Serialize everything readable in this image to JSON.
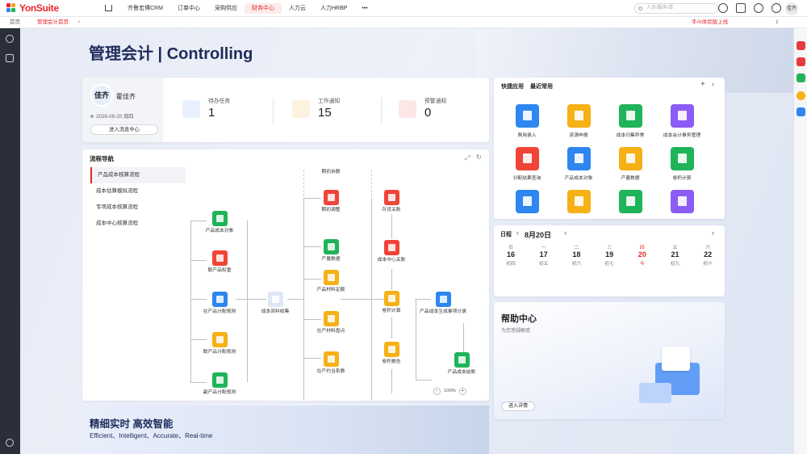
{
  "brand": {
    "name": "YonSuite"
  },
  "top_menu": [
    {
      "label": "齐鲁宏博CRM"
    },
    {
      "label": "订单中心"
    },
    {
      "label": "采购供应"
    },
    {
      "label": "财务中心",
      "active": true
    },
    {
      "label": "人力云"
    },
    {
      "label": "人力HRBP"
    },
    {
      "label": "•••"
    }
  ],
  "search": {
    "placeholder": "人员/服务/单"
  },
  "user_avatar_top": "佳齐",
  "tabs": {
    "home": "首页",
    "current": "管理会计首页",
    "close": "×"
  },
  "promo": "手AI体验版上线",
  "page_title": "管理会计 | Controlling",
  "user": {
    "avatar": "佳齐",
    "name": "霍佳齐",
    "date": "2026-08-20 周四",
    "button": "进入消息中心"
  },
  "stats": [
    {
      "label": "待办任务",
      "value": "1",
      "color": "#3d7cf0",
      "bg": "#e8f0fe"
    },
    {
      "label": "工作通知",
      "value": "15",
      "color": "#f4a11c",
      "bg": "#fdf1df"
    },
    {
      "label": "预警通知",
      "value": "0",
      "color": "#e8393f",
      "bg": "#fde6e6"
    }
  ],
  "flow": {
    "title": "流程导航",
    "list": [
      "产品成本核算流程",
      "成本估算模拟流程",
      "专项成本核算流程",
      "成本中心核算流程"
    ],
    "nodes": {
      "n1": "产品成本对象",
      "n2": "联产品权重",
      "n3": "在产品分配规则",
      "n4": "联产品分配规则",
      "n5": "副产品分配规则",
      "n6": "成本资料收集",
      "n7": "期初余额",
      "n8": "期初调整",
      "n9": "产量数据",
      "n10": "产品材料定额",
      "n11": "在产材料盘点",
      "n12": "在产约当系数",
      "n13": "存货关账",
      "n14": "成本中心关账",
      "n15": "卷积计算",
      "n16": "卷积报告",
      "n17": "产品成本生成事项分录",
      "n18": "产品成本结账"
    },
    "zoom": "100%"
  },
  "quick": {
    "tabs": [
      "快捷应用",
      "最近常用"
    ],
    "apps": [
      {
        "label": "费用录入",
        "color": "#2e86f0"
      },
      {
        "label": "资源申报",
        "color": "#f5b116"
      },
      {
        "label": "成本归集异常",
        "color": "#1fb35a"
      },
      {
        "label": "成本会计事务管理",
        "color": "#8b5cf6"
      },
      {
        "label": "分配结果查询",
        "color": "#f04438"
      },
      {
        "label": "产品成本对象",
        "color": "#2e86f0"
      },
      {
        "label": "产量数据",
        "color": "#f5b116"
      },
      {
        "label": "卷积计算",
        "color": "#1fb35a"
      },
      {
        "label": "",
        "color": "#2e86f0"
      },
      {
        "label": "",
        "color": "#f5b116"
      },
      {
        "label": "",
        "color": "#1fb35a"
      },
      {
        "label": "",
        "color": "#8b5cf6"
      }
    ]
  },
  "calendar": {
    "title": "日程",
    "month": "8月20日",
    "days": [
      {
        "w": "日",
        "d": "16",
        "l": "初四"
      },
      {
        "w": "一",
        "d": "17",
        "l": "初五"
      },
      {
        "w": "二",
        "d": "18",
        "l": "初六"
      },
      {
        "w": "三",
        "d": "19",
        "l": "初七"
      },
      {
        "w": "四",
        "d": "20",
        "l": "今",
        "today": true
      },
      {
        "w": "五",
        "d": "21",
        "l": "初九"
      },
      {
        "w": "六",
        "d": "22",
        "l": "初十"
      }
    ]
  },
  "help": {
    "title": "帮助中心",
    "subtitle": "为您答疑解惑",
    "button": "进入详情"
  },
  "banner": {
    "title": "精细实时 高效智能",
    "subtitle": "Efficient、Intelligent、Accurate、Real-time"
  }
}
